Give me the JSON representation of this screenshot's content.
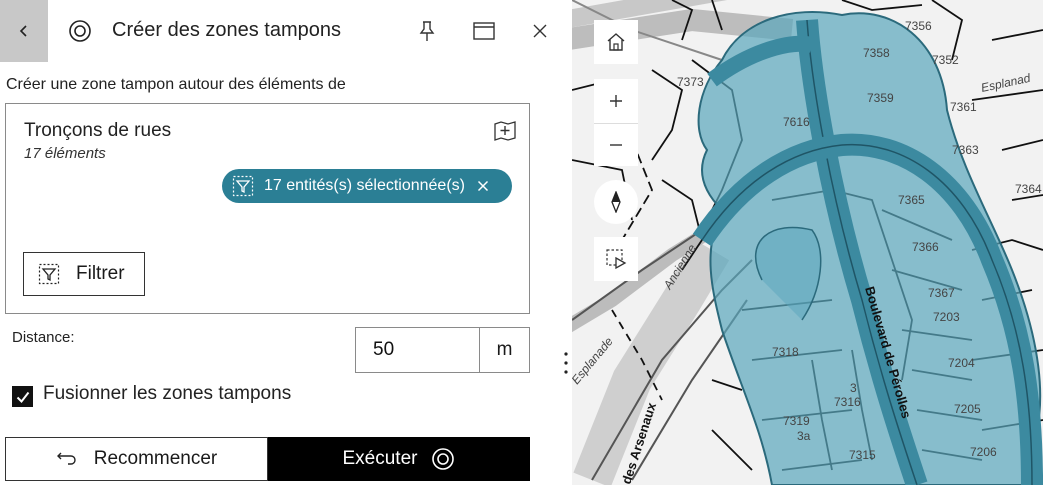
{
  "header": {
    "title": "Créer des zones tampons"
  },
  "intro_text": "Créer une zone tampon autour des éléments de",
  "layer": {
    "name": "Tronçons de rues",
    "count": "17 éléments",
    "selection_chip": "17 entités(s) sélectionnée(s)",
    "filter_label": "Filtrer"
  },
  "distance": {
    "label": "Distance:",
    "value": "50",
    "unit": "m"
  },
  "merge": {
    "label": "Fusionner les zones tampons",
    "checked": true
  },
  "actions": {
    "reset_label": "Recommencer",
    "run_label": "Exécuter"
  },
  "colors": {
    "accent": "#2b7f95",
    "buffer_fill": "#5aa6bc",
    "button_dark": "#000000",
    "back_button": "#c8c8c8"
  },
  "map": {
    "street_labels": {
      "boulevard": "Boulevard de Pérolles",
      "arsenaux": "des Arsenaux",
      "esplanade": "Esplanad",
      "esplanade_left": "Esplanade",
      "ancienne": "Ancienne"
    },
    "parcels": [
      "7356",
      "7358",
      "7352",
      "7373",
      "7359",
      "7361",
      "7616",
      "7363",
      "7364",
      "7365",
      "7366",
      "7367",
      "7203",
      "7318",
      "7204",
      "7316",
      "7205",
      "7319",
      "7315",
      "7206",
      "3",
      "3a"
    ]
  }
}
